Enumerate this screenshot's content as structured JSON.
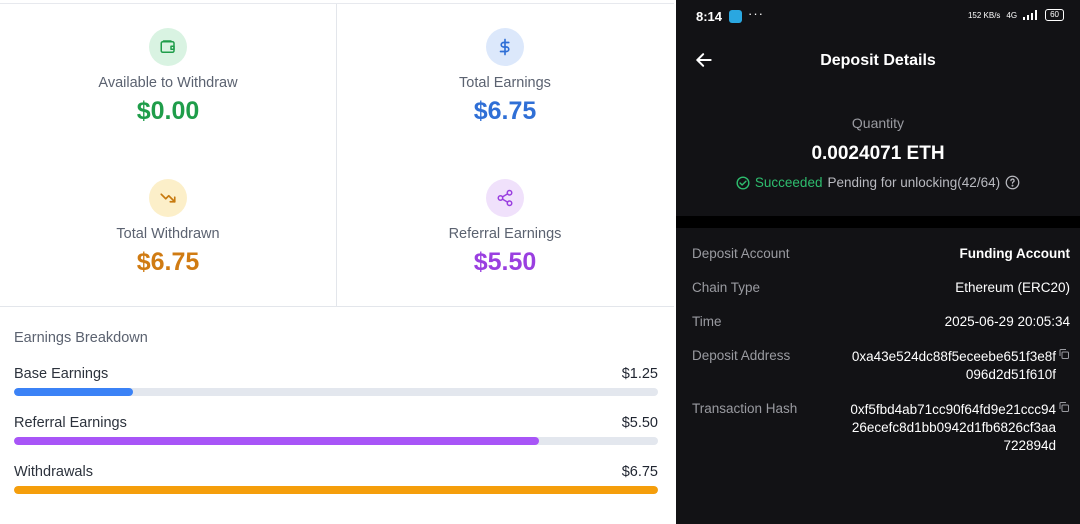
{
  "dashboard": {
    "stats": [
      {
        "label": "Available to Withdraw",
        "value": "$0.00",
        "color": "#1f9d4a",
        "icon": "wallet-icon",
        "icon_bg": "#d9f3e2",
        "icon_color": "#1f9d4a"
      },
      {
        "label": "Total Earnings",
        "value": "$6.75",
        "color": "#2f6fd6",
        "icon": "dollar-icon",
        "icon_bg": "#dce8fb",
        "icon_color": "#2f6fd6"
      },
      {
        "label": "Total Withdrawn",
        "value": "$6.75",
        "color": "#d07b12",
        "icon": "trending-down-icon",
        "icon_bg": "#fcefc9",
        "icon_color": "#c77a10"
      },
      {
        "label": "Referral Earnings",
        "value": "$5.50",
        "color": "#9a3fe0",
        "icon": "share-icon",
        "icon_bg": "#f0e1fb",
        "icon_color": "#9a3fe0"
      }
    ],
    "breakdown": {
      "title": "Earnings Breakdown",
      "rows": [
        {
          "label": "Base Earnings",
          "amount": "$1.25",
          "fraction": 0.185,
          "color": "#3b82f6"
        },
        {
          "label": "Referral Earnings",
          "amount": "$5.50",
          "fraction": 0.815,
          "color": "#a855f7"
        },
        {
          "label": "Withdrawals",
          "amount": "$6.75",
          "fraction": 1.0,
          "color": "#f59e0b"
        }
      ]
    }
  },
  "phone": {
    "status_bar": {
      "time": "8:14",
      "dots": "···",
      "speed": "152 KB/s",
      "network": "4G",
      "battery": "60"
    },
    "title": "Deposit Details",
    "quantity_label": "Quantity",
    "quantity_value": "0.0024071 ETH",
    "status_ok": "Succeeded",
    "status_pending": "Pending for unlocking(42/64)",
    "details": {
      "deposit_account_label": "Deposit Account",
      "deposit_account_value": "Funding Account",
      "chain_type_label": "Chain Type",
      "chain_type_value": "Ethereum (ERC20)",
      "time_label": "Time",
      "time_value": "2025-06-29 20:05:34",
      "address_label": "Deposit Address",
      "address_value": "0xa43e524dc88f5eceebe651f3e8f096d2d51f610f",
      "hash_label": "Transaction Hash",
      "hash_value": "0xf5fbd4ab71cc90f64fd9e21ccc9426ecefc8d1bb0942d1fb6826cf3aa722894d"
    }
  }
}
